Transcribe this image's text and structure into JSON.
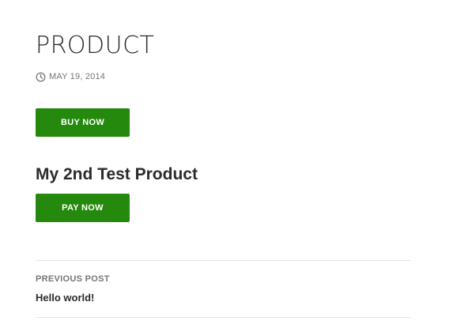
{
  "entry": {
    "title": "PRODUCT",
    "date_icon": "clock-icon",
    "date": "MAY 19, 2014"
  },
  "buttons": {
    "buy_label": "BUY NOW",
    "pay_label": "PAY NOW",
    "color": "#24890d"
  },
  "product": {
    "name": "My 2nd Test Product"
  },
  "post_navigation": {
    "label": "PREVIOUS POST",
    "link_text": "Hello world!"
  }
}
